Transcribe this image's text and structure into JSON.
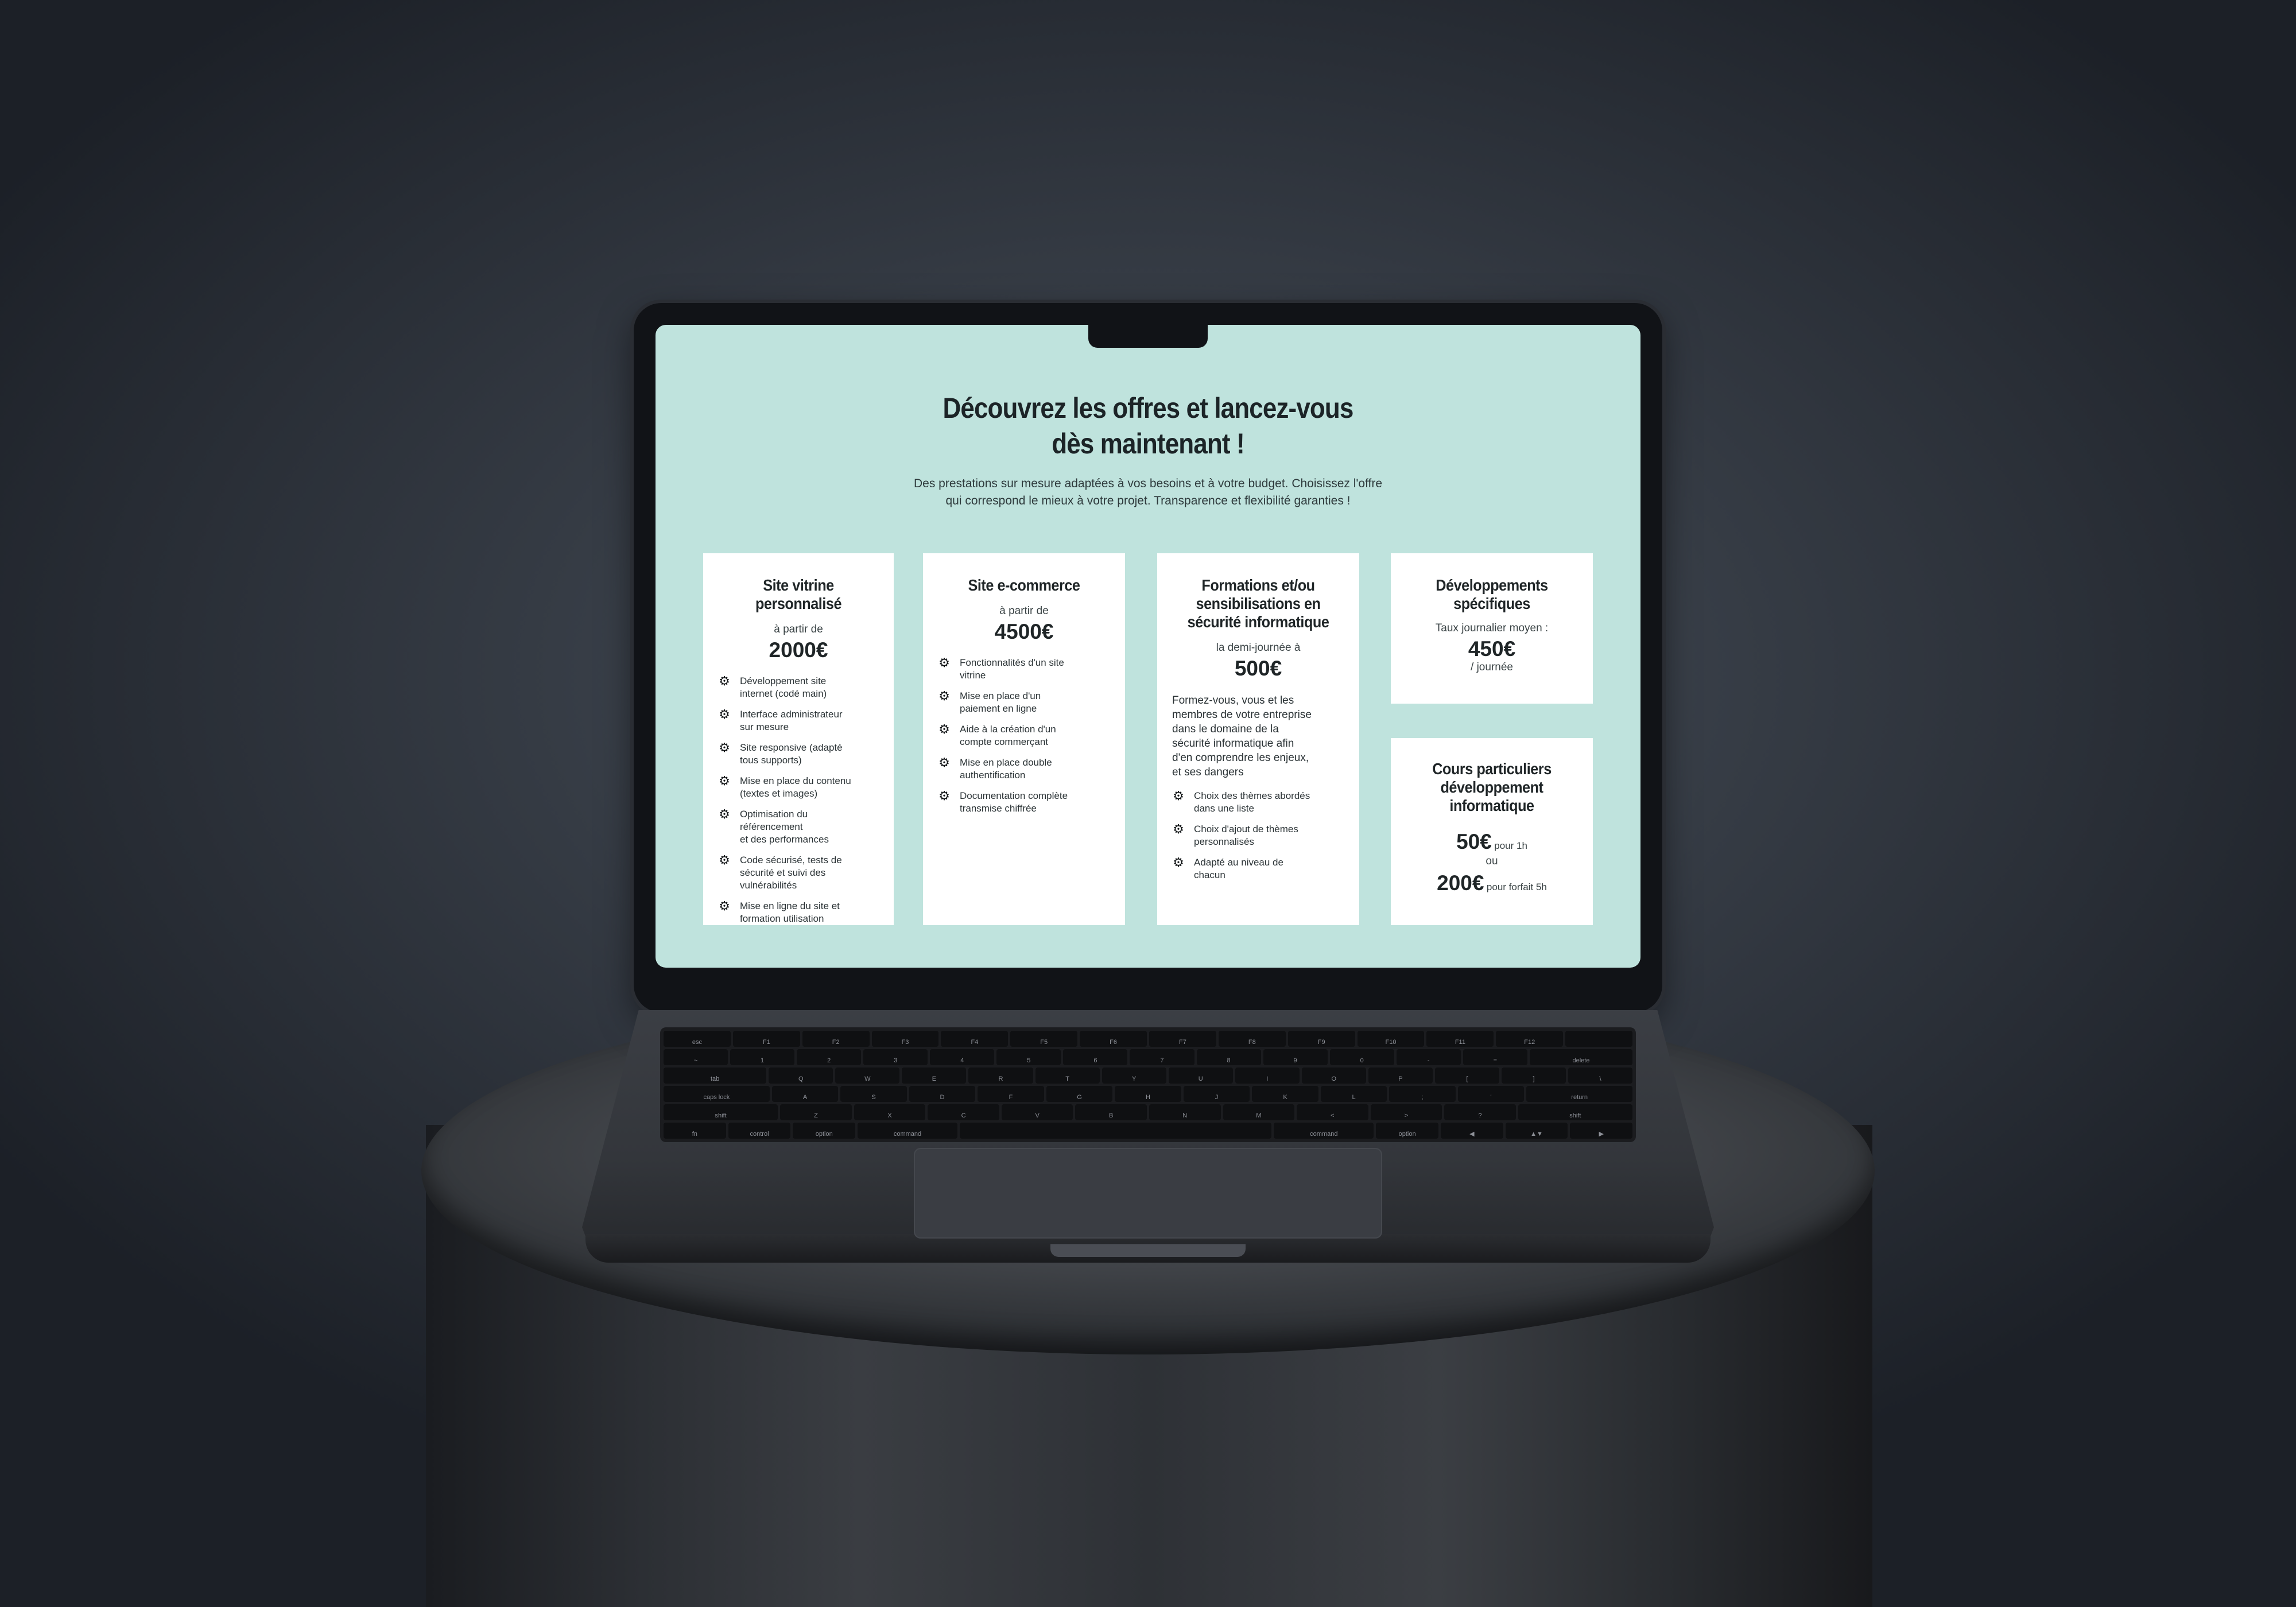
{
  "header": {
    "title_line1": "Découvrez les offres et lancez-vous",
    "title_line2": "dès maintenant !",
    "subtitle_line1": "Des prestations sur mesure adaptées à vos besoins et à votre budget. Choisissez l'offre",
    "subtitle_line2": "qui correspond le mieux à votre projet. Transparence et flexibilité garanties !"
  },
  "cards": [
    {
      "title": "Site vitrine personnalisé",
      "from": "à partir de",
      "price": "2000€",
      "features": [
        [
          "Développement site",
          "internet (codé main)"
        ],
        [
          "Interface administrateur",
          "sur mesure"
        ],
        [
          "Site responsive (adapté",
          "tous supports)"
        ],
        [
          "Mise en place du contenu",
          "(textes et images)"
        ],
        [
          "Optimisation du",
          "référencement",
          " et des performances"
        ],
        [
          "Code sécurisé, tests de",
          "sécurité et suivi des",
          "vulnérabilités"
        ],
        [
          "Mise en ligne du site et",
          "formation utilisation"
        ]
      ]
    },
    {
      "title": "Site e-commerce",
      "from": "à partir de",
      "price": "4500€",
      "features": [
        [
          "Fonctionnalités d'un site",
          "vitrine"
        ],
        [
          "Mise en place d'un",
          "paiement en ligne"
        ],
        [
          "Aide à la création d'un",
          "compte commerçant"
        ],
        [
          "Mise en place double",
          "authentification"
        ],
        [
          "Documentation complète",
          "transmise chiffrée"
        ]
      ]
    },
    {
      "title_lines": [
        "Formations et/ou",
        "sensibilisations en",
        "sécurité informatique"
      ],
      "from": "la demi-journée à",
      "price": "500€",
      "description": [
        "Formez-vous, vous et les",
        "membres de votre entreprise",
        "dans le domaine de la",
        "sécurité informatique afin",
        "d'en comprendre les enjeux,",
        "et ses dangers"
      ],
      "features": [
        [
          "Choix des thèmes abordés",
          "dans une liste"
        ],
        [
          "Choix d'ajout de thèmes",
          "personnalisés"
        ],
        [
          "Adapté au niveau de",
          "chacun"
        ]
      ]
    },
    {
      "title_lines": [
        "Développements",
        "spécifiques"
      ],
      "rate_label": "Taux journalier moyen :",
      "price": "450€",
      "per": "/ journée"
    },
    {
      "title_lines": [
        "Cours particuliers",
        "développement",
        "informatique"
      ],
      "price1": "50€",
      "price1_suffix": "pour 1h",
      "or": "ou",
      "price2": "200€",
      "price2_suffix": "pour forfait 5h"
    }
  ],
  "keyboard": {
    "row1": [
      "esc",
      "F1",
      "F2",
      "F3",
      "F4",
      "F5",
      "F6",
      "F7",
      "F8",
      "F9",
      "F10",
      "F11",
      "F12",
      ""
    ],
    "row2": [
      "~",
      "1",
      "2",
      "3",
      "4",
      "5",
      "6",
      "7",
      "8",
      "9",
      "0",
      "-",
      "=",
      "delete"
    ],
    "row3": [
      "tab",
      "Q",
      "W",
      "E",
      "R",
      "T",
      "Y",
      "U",
      "I",
      "O",
      "P",
      "[",
      "]",
      "\\"
    ],
    "row4": [
      "caps lock",
      "A",
      "S",
      "D",
      "F",
      "G",
      "H",
      "J",
      "K",
      "L",
      ";",
      "'",
      "return"
    ],
    "row5": [
      "shift",
      "Z",
      "X",
      "C",
      "V",
      "B",
      "N",
      "M",
      "<",
      ">",
      "?",
      "shift"
    ],
    "row6": [
      "fn",
      "control",
      "option",
      "command",
      "",
      "command",
      "option",
      "◀",
      "▲▼",
      "▶"
    ]
  },
  "colors": {
    "screen_bg": "#bfe3dd",
    "card_bg": "#ffffff",
    "text_dark": "#1f2527"
  },
  "icons": {
    "feature_bullet": "gear-icon"
  }
}
